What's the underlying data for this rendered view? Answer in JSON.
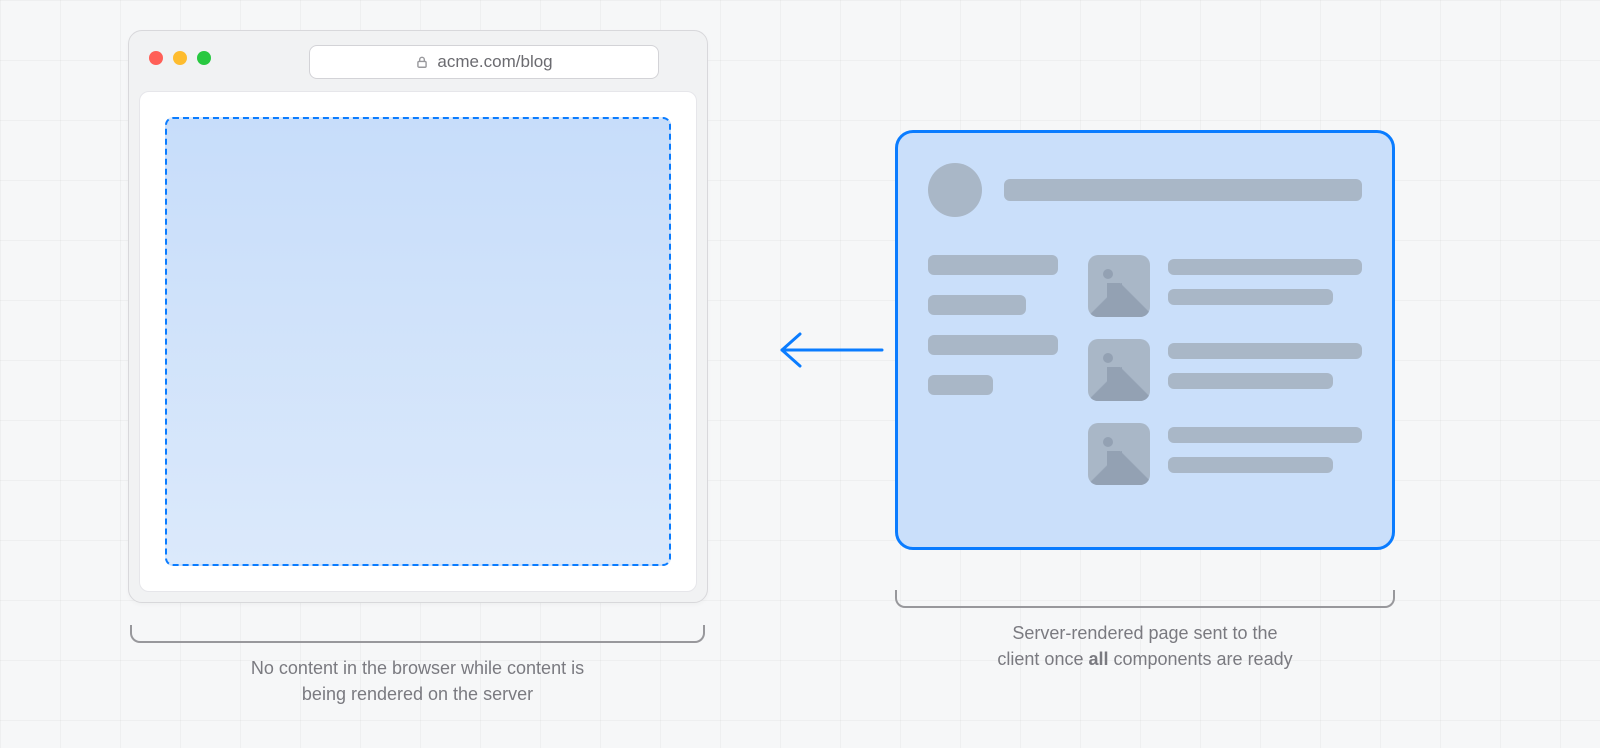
{
  "url_bar": {
    "text": "acme.com/blog"
  },
  "captions": {
    "left_line1": "No content in the browser while content is",
    "left_line2": "being rendered on the server",
    "right_line1": "Server-rendered page sent to the",
    "right_pre": "client once ",
    "right_bold": "all",
    "right_post": " components are ready"
  },
  "colors": {
    "accent": "#0a7cff"
  }
}
